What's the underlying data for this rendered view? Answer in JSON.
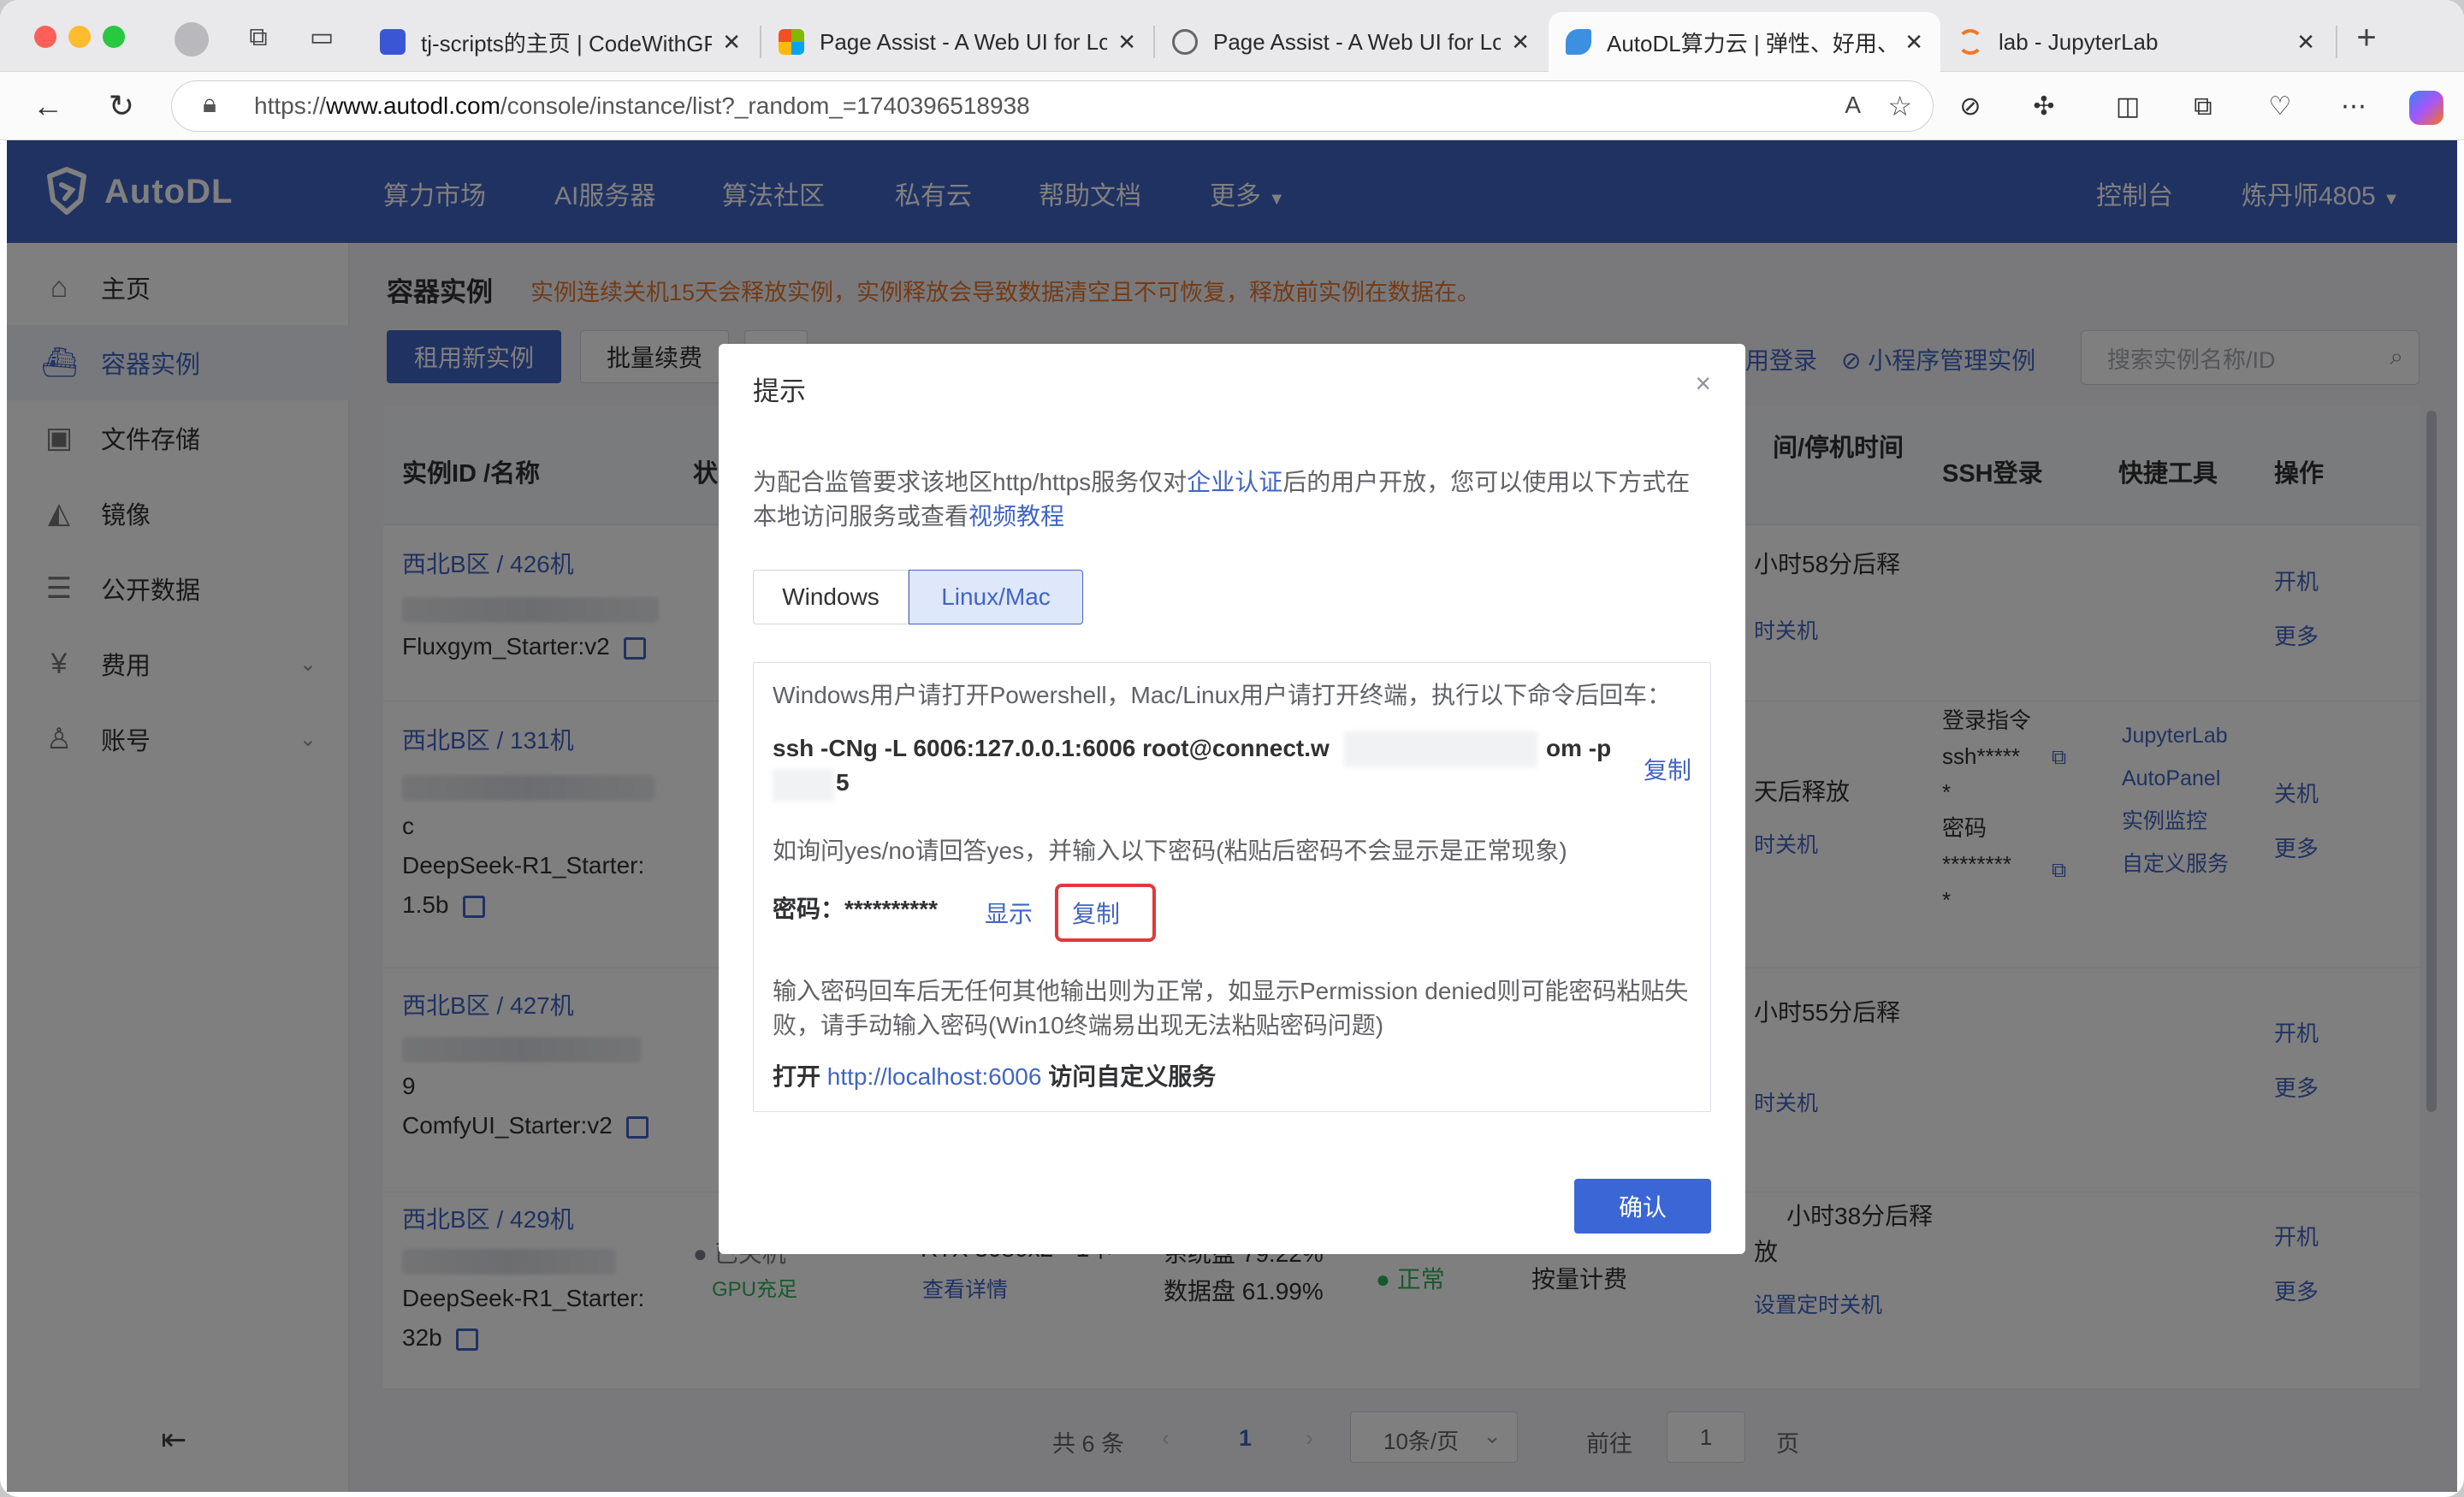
{
  "browser": {
    "tabs": [
      {
        "title": "tj-scripts的主页 | CodeWithGP",
        "color": "#3a56d4"
      },
      {
        "title": "Page Assist - A Web UI for Lo",
        "color": "#f25022"
      },
      {
        "title": "Page Assist - A Web UI for Lo",
        "color": "#7a7a7a"
      },
      {
        "title": "AutoDL算力云 | 弹性、好用、省",
        "color": "#3d8fe0"
      },
      {
        "title": "lab - JupyterLab",
        "color": "#f37726"
      }
    ],
    "url_prefix": "https://",
    "url_host": "www.autodl.com",
    "url_path": "/console/instance/list?_random_=1740396518938",
    "tab_close": "✕",
    "new_tab": "+"
  },
  "topnav": {
    "logo": "AutoDL",
    "items": [
      "算力市场",
      "AI服务器",
      "算法社区",
      "私有云",
      "帮助文档",
      "更多"
    ],
    "right": [
      "控制台",
      "炼丹师4805"
    ]
  },
  "sidebar": {
    "items": [
      "主页",
      "容器实例",
      "文件存储",
      "镜像",
      "公开数据",
      "费用",
      "账号"
    ]
  },
  "content": {
    "title": "容器实例",
    "warning": "实例连续关机15天会释放实例，实例释放会导致数据清空且不可恢复，释放前实例在数据在。",
    "btn_new": "租用新实例",
    "btn_renew": "批量续费",
    "link_login": "用登录",
    "link_miniprogram": "小程序管理实例",
    "search_placeholder": "搜索实例名称/ID",
    "headers": [
      "实例ID /名称",
      "状",
      "间/停机时间",
      "SSH登录",
      "快捷工具",
      "操作"
    ],
    "rows": [
      {
        "region": "西北B区 / 426机",
        "name": "Fluxgym_Starter:v2",
        "time": "小时58分后释",
        "sched": "时关机",
        "ops": [
          "开机",
          "更多"
        ]
      },
      {
        "region": "西北B区 / 131机",
        "name1": "c",
        "name2": "DeepSeek-R1_Starter:",
        "name3": "1.5b",
        "time": "天后释放",
        "sched": "时关机",
        "ssh": [
          "登录指令",
          "ssh*****",
          "*",
          "密码",
          "********",
          "*"
        ],
        "tools": [
          "JupyterLab",
          "AutoPanel",
          "实例监控",
          "自定义服务"
        ],
        "ops": [
          "关机",
          "更多"
        ]
      },
      {
        "region": "西北B区 / 427机",
        "name1": "9",
        "name2": "ComfyUI_Starter:v2",
        "time": "小时55分后释",
        "sched": "时关机",
        "ops": [
          "开机",
          "更多"
        ]
      },
      {
        "region": "西北B区 / 429机",
        "name1": "DeepSeek-R1_Starter:",
        "name2": "32b",
        "status": "已关机",
        "gpu": "GPU充足",
        "spec": "RTX 3080x2 * 1卡",
        "detail": "查看详情",
        "disk1": "系统盘 79.22%",
        "disk2": "数据盘 61.99%",
        "health": "正常",
        "billing": "按量计费",
        "time": "小时38分后释",
        "time2": "放",
        "sched": "设置定时关机",
        "ops": [
          "开机",
          "更多"
        ]
      }
    ],
    "pager": {
      "total": "共 6 条",
      "page": "1",
      "size": "10条/页",
      "goto": "前往",
      "goto_val": "1",
      "unit": "页"
    }
  },
  "dialog": {
    "title": "提示",
    "intro_1": "为配合监管要求该地区http/https服务仅对",
    "intro_link1": "企业认证",
    "intro_2": "后的用户开放，您可以使用以下方式在本地访问服务或查看",
    "intro_link2": "视频教程",
    "tab_windows": "Windows",
    "tab_linux": "Linux/Mac",
    "line1": "Windows用户请打开Powershell，Mac/Linux用户请打开终端，执行以下命令后回车：",
    "cmd_a": "ssh -CNg -L 6006:127.0.0.1:6006 root@connect.w",
    "cmd_b": "om -p",
    "cmd_c": "5",
    "copy1": "复制",
    "line2": "如询问yes/no请回答yes，并输入以下密码(粘贴后密码不会显示是正常现象)",
    "pwd_label": "密码：**********",
    "show": "显示",
    "copy2": "复制",
    "line3": "输入密码回车后无任何其他输出则为正常，如显示Permission denied则可能密码粘贴失 败，请手动输入密码(Win10终端易出现无法粘贴密码问题)",
    "open": "打开",
    "open_url": "http://localhost:6006",
    "open_tail": "访问自定义服务",
    "ok": "确认",
    "close": "×"
  }
}
